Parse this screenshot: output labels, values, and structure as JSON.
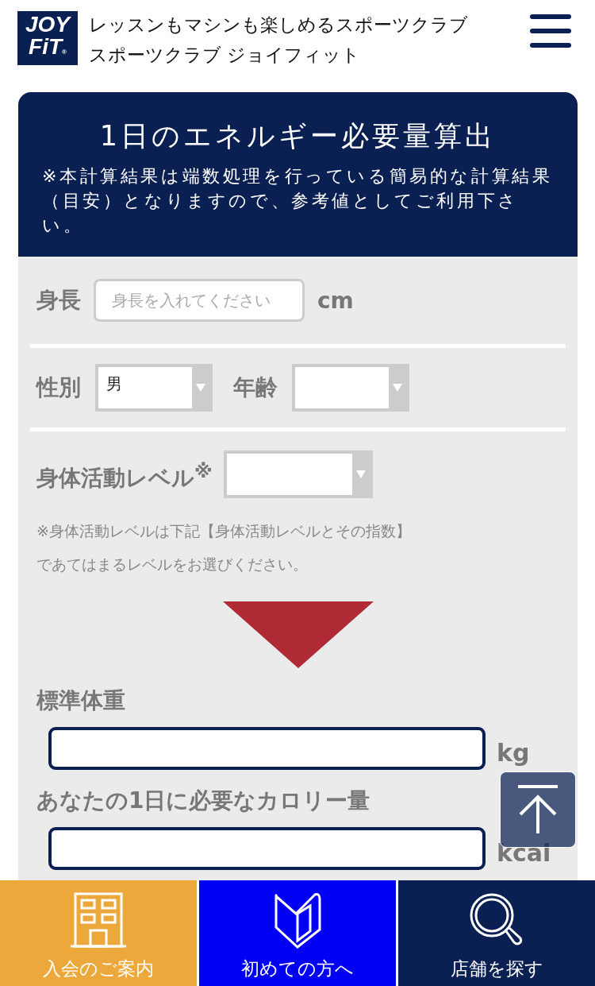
{
  "header": {
    "logo": {
      "line1": "JOY",
      "line2": "FiT",
      "mark": "®"
    },
    "tagline": "レッスンもマシンも楽しめるスポーツクラブ",
    "site_name": "スポーツクラブ ジョイフィット"
  },
  "calculator": {
    "title": "1日のエネルギー必要量算出",
    "note": "※本計算結果は端数処理を行っている簡易的な計算結果（目安）となりますので、参考値としてご利用下さい。",
    "height": {
      "label": "身長",
      "placeholder": "身長を入れてください",
      "unit": "cm"
    },
    "gender": {
      "label": "性別",
      "value": "男"
    },
    "age": {
      "label": "年齢"
    },
    "activity": {
      "label": "身体活動レベル$^{※}$",
      "note_lines": [
        "※身体活動レベルは下記【身体活動レベルとその指数】",
        "であてはまるレベルをお選びください。"
      ]
    },
    "standard_weight": {
      "label": "標準体重",
      "unit": "kg"
    },
    "calories": {
      "label": "あなたの1日に必要なカロリー量",
      "unit": "kcal"
    }
  },
  "bottom_nav": [
    {
      "label": "入会のご案内",
      "kind": "building",
      "color": "#eca83a"
    },
    {
      "label": "初めての方へ",
      "kind": "beginner",
      "color": "#0000f5"
    },
    {
      "label": "店舗を探す",
      "kind": "search",
      "color": "#0a1f52"
    }
  ]
}
